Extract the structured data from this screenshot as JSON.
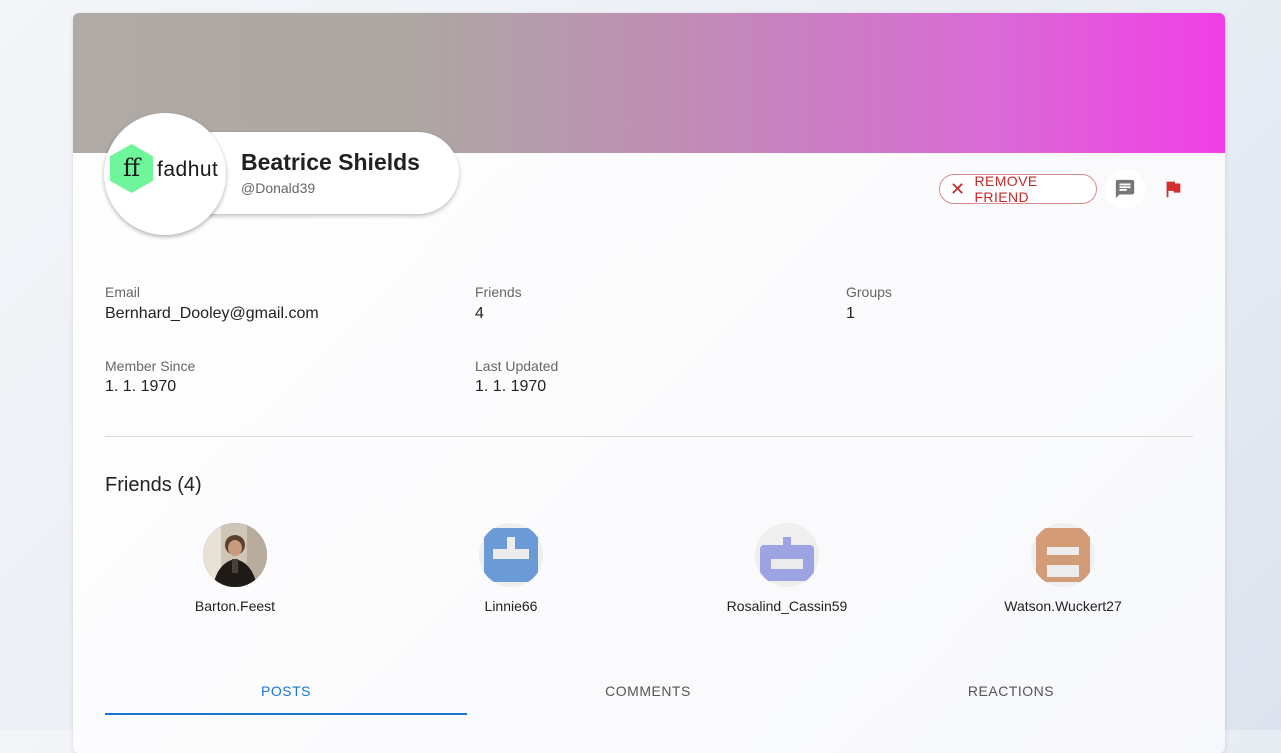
{
  "profile": {
    "name": "Beatrice Shields",
    "handle": "@Donald39",
    "logo_text": "fadhut",
    "logo_mark": "ff"
  },
  "actions": {
    "remove_friend_label": "REMOVE FRIEND",
    "message_icon": "chat-icon",
    "report_icon": "flag-icon"
  },
  "fields": [
    {
      "label": "Email",
      "value": "Bernhard_Dooley@gmail.com"
    },
    {
      "label": "Friends",
      "value": "4"
    },
    {
      "label": "Groups",
      "value": "1"
    },
    {
      "label": "Member Since",
      "value": "1. 1. 1970"
    },
    {
      "label": "Last Updated",
      "value": "1. 1. 1970"
    }
  ],
  "friends_section": {
    "title": "Friends (4)",
    "friends": [
      {
        "name": "Barton.Feest",
        "avatar": "photo"
      },
      {
        "name": "Linnie66",
        "avatar": "identicon",
        "color": "#6b9bd6"
      },
      {
        "name": "Rosalind_Cassin59",
        "avatar": "identicon",
        "color": "#9da3e3"
      },
      {
        "name": "Watson.Wuckert27",
        "avatar": "identicon",
        "color": "#d39b76"
      }
    ]
  },
  "tabs": [
    {
      "label": "POSTS",
      "active": true
    },
    {
      "label": "COMMENTS",
      "active": false
    },
    {
      "label": "REACTIONS",
      "active": false
    }
  ],
  "colors": {
    "accent": "#1976d2",
    "danger": "#c62828",
    "logo_green": "#6ff59a"
  }
}
